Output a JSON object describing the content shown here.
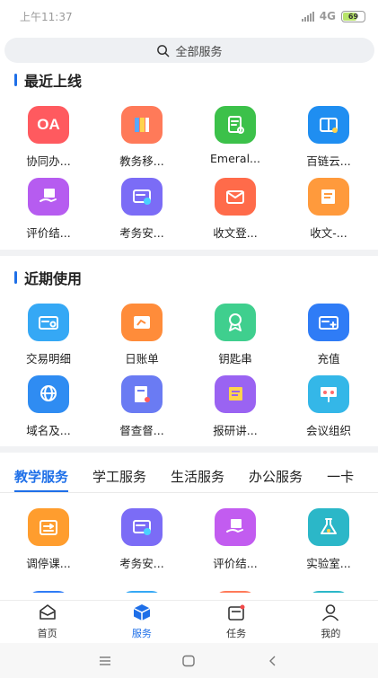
{
  "status_bar": {
    "time": "上午11:37",
    "network": "4G",
    "battery": "69",
    "battery_level": 0.69
  },
  "search": {
    "label": "全部服务",
    "icon": "search-icon"
  },
  "recent_section": {
    "title": "最近上线",
    "items": [
      {
        "label": "协同办...",
        "icon": "oa-icon",
        "color": "#ff5a5f",
        "glyph": "OA"
      },
      {
        "label": "教务移...",
        "icon": "books-icon",
        "color": "#ff7a59"
      },
      {
        "label": "Emeral...",
        "icon": "document-search-icon",
        "color": "#3cc14a"
      },
      {
        "label": "百链云...",
        "icon": "book-search-icon",
        "color": "#1f8ef1"
      },
      {
        "label": "评价结...",
        "icon": "hand-book-icon",
        "color": "#b65cf0"
      },
      {
        "label": "考务安...",
        "icon": "exam-clock-icon",
        "color": "#7b6cf6"
      },
      {
        "label": "收文登...",
        "icon": "mail-register-icon",
        "color": "#ff6b4a"
      },
      {
        "label": "收文-...",
        "icon": "mail-edit-icon",
        "color": "#ff9a3c"
      }
    ]
  },
  "usage_section": {
    "title": "近期使用",
    "items": [
      {
        "label": "交易明细",
        "icon": "card-search-icon",
        "color": "#35a8f5"
      },
      {
        "label": "日账单",
        "icon": "bill-icon",
        "color": "#ff8c3a"
      },
      {
        "label": "钥匙串",
        "icon": "ribbon-icon",
        "color": "#3fcf8e"
      },
      {
        "label": "充值",
        "icon": "card-add-icon",
        "color": "#2f7cf6"
      },
      {
        "label": "域名及...",
        "icon": "globe-ip-icon",
        "color": "#2f8cf2"
      },
      {
        "label": "督查督...",
        "icon": "inspection-icon",
        "color": "#6a7bf3"
      },
      {
        "label": "报研讲...",
        "icon": "report-icon",
        "color": "#9a63f2"
      },
      {
        "label": "会议组织",
        "icon": "meeting-icon",
        "color": "#34b7e8"
      }
    ]
  },
  "service_tabs": [
    "教学服务",
    "学工服务",
    "生活服务",
    "办公服务",
    "一卡"
  ],
  "active_tab": 0,
  "teaching_items": [
    {
      "label": "调停课...",
      "icon": "calendar-swap-icon",
      "color": "#ff9d2e"
    },
    {
      "label": "考务安...",
      "icon": "exam-clock-icon",
      "color": "#7b6cf6"
    },
    {
      "label": "评价结...",
      "icon": "hand-book-icon",
      "color": "#c25cf0"
    },
    {
      "label": "实验室...",
      "icon": "flask-icon",
      "color": "#2bb7c8"
    }
  ],
  "bottom_nav": [
    {
      "label": "首页",
      "icon": "home-mail-icon"
    },
    {
      "label": "服务",
      "icon": "cube-icon"
    },
    {
      "label": "任务",
      "icon": "task-icon"
    },
    {
      "label": "我的",
      "icon": "user-icon"
    }
  ],
  "active_nav": 1,
  "accent_color": "#1e6fe8"
}
